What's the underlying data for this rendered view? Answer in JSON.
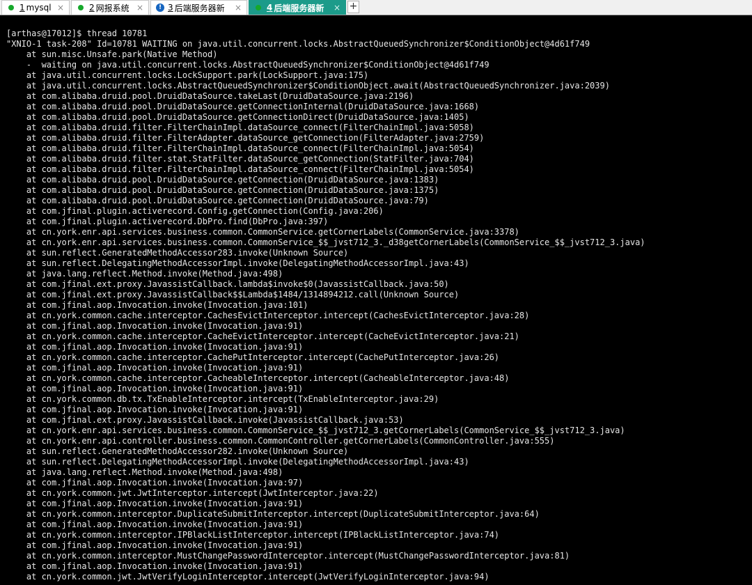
{
  "tabs": [
    {
      "num": "1",
      "label": "mysql",
      "status": "connected",
      "icon": "green-dot-icon",
      "active": false
    },
    {
      "num": "2",
      "label": "网报系统",
      "status": "connected",
      "icon": "green-dot-icon",
      "active": false
    },
    {
      "num": "3",
      "label": "后端服务器新",
      "status": "warning",
      "icon": "info-icon",
      "active": false
    },
    {
      "num": "4",
      "label": "后端服务器新",
      "status": "connected",
      "icon": "green-dot-icon",
      "active": true
    }
  ],
  "add_tab_label": "+",
  "close_label": "×",
  "warn_symbol": "!",
  "colors": {
    "active_tab": "#1c9b8a",
    "connected": "#16a82b",
    "info": "#1565c0",
    "terminal_bg": "#000000",
    "terminal_fg": "#e6e6e6"
  },
  "terminal": {
    "lines": [
      "[arthas@17012]$ thread 10781",
      "\"XNIO-1 task-208\" Id=10781 WAITING on java.util.concurrent.locks.AbstractQueuedSynchronizer$ConditionObject@4d61f749",
      "    at sun.misc.Unsafe.park(Native Method)",
      "    -  waiting on java.util.concurrent.locks.AbstractQueuedSynchronizer$ConditionObject@4d61f749",
      "    at java.util.concurrent.locks.LockSupport.park(LockSupport.java:175)",
      "    at java.util.concurrent.locks.AbstractQueuedSynchronizer$ConditionObject.await(AbstractQueuedSynchronizer.java:2039)",
      "    at com.alibaba.druid.pool.DruidDataSource.takeLast(DruidDataSource.java:2196)",
      "    at com.alibaba.druid.pool.DruidDataSource.getConnectionInternal(DruidDataSource.java:1668)",
      "    at com.alibaba.druid.pool.DruidDataSource.getConnectionDirect(DruidDataSource.java:1405)",
      "    at com.alibaba.druid.filter.FilterChainImpl.dataSource_connect(FilterChainImpl.java:5058)",
      "    at com.alibaba.druid.filter.FilterAdapter.dataSource_getConnection(FilterAdapter.java:2759)",
      "    at com.alibaba.druid.filter.FilterChainImpl.dataSource_connect(FilterChainImpl.java:5054)",
      "    at com.alibaba.druid.filter.stat.StatFilter.dataSource_getConnection(StatFilter.java:704)",
      "    at com.alibaba.druid.filter.FilterChainImpl.dataSource_connect(FilterChainImpl.java:5054)",
      "    at com.alibaba.druid.pool.DruidDataSource.getConnection(DruidDataSource.java:1383)",
      "    at com.alibaba.druid.pool.DruidDataSource.getConnection(DruidDataSource.java:1375)",
      "    at com.alibaba.druid.pool.DruidDataSource.getConnection(DruidDataSource.java:79)",
      "    at com.jfinal.plugin.activerecord.Config.getConnection(Config.java:206)",
      "    at com.jfinal.plugin.activerecord.DbPro.find(DbPro.java:397)",
      "    at cn.york.enr.api.services.business.common.CommonService.getCornerLabels(CommonService.java:3378)",
      "    at cn.york.enr.api.services.business.common.CommonService_$$_jvst712_3._d38getCornerLabels(CommonService_$$_jvst712_3.java)",
      "    at sun.reflect.GeneratedMethodAccessor283.invoke(Unknown Source)",
      "    at sun.reflect.DelegatingMethodAccessorImpl.invoke(DelegatingMethodAccessorImpl.java:43)",
      "    at java.lang.reflect.Method.invoke(Method.java:498)",
      "    at com.jfinal.ext.proxy.JavassistCallback.lambda$invoke$0(JavassistCallback.java:50)",
      "    at com.jfinal.ext.proxy.JavassistCallback$$Lambda$1484/1314894212.call(Unknown Source)",
      "    at com.jfinal.aop.Invocation.invoke(Invocation.java:101)",
      "    at cn.york.common.cache.interceptor.CachesEvictInterceptor.intercept(CachesEvictInterceptor.java:28)",
      "    at com.jfinal.aop.Invocation.invoke(Invocation.java:91)",
      "    at cn.york.common.cache.interceptor.CacheEvictInterceptor.intercept(CacheEvictInterceptor.java:21)",
      "    at com.jfinal.aop.Invocation.invoke(Invocation.java:91)",
      "    at cn.york.common.cache.interceptor.CachePutInterceptor.intercept(CachePutInterceptor.java:26)",
      "    at com.jfinal.aop.Invocation.invoke(Invocation.java:91)",
      "    at cn.york.common.cache.interceptor.CacheableInterceptor.intercept(CacheableInterceptor.java:48)",
      "    at com.jfinal.aop.Invocation.invoke(Invocation.java:91)",
      "    at cn.york.common.db.tx.TxEnableInterceptor.intercept(TxEnableInterceptor.java:29)",
      "    at com.jfinal.aop.Invocation.invoke(Invocation.java:91)",
      "    at com.jfinal.ext.proxy.JavassistCallback.invoke(JavassistCallback.java:53)",
      "    at cn.york.enr.api.services.business.common.CommonService_$$_jvst712_3.getCornerLabels(CommonService_$$_jvst712_3.java)",
      "    at cn.york.enr.api.controller.business.common.CommonController.getCornerLabels(CommonController.java:555)",
      "    at sun.reflect.GeneratedMethodAccessor282.invoke(Unknown Source)",
      "    at sun.reflect.DelegatingMethodAccessorImpl.invoke(DelegatingMethodAccessorImpl.java:43)",
      "    at java.lang.reflect.Method.invoke(Method.java:498)",
      "    at com.jfinal.aop.Invocation.invoke(Invocation.java:97)",
      "    at cn.york.common.jwt.JwtInterceptor.intercept(JwtInterceptor.java:22)",
      "    at com.jfinal.aop.Invocation.invoke(Invocation.java:91)",
      "    at cn.york.common.interceptor.DuplicateSubmitInterceptor.intercept(DuplicateSubmitInterceptor.java:64)",
      "    at com.jfinal.aop.Invocation.invoke(Invocation.java:91)",
      "    at cn.york.common.interceptor.IPBlackListInterceptor.intercept(IPBlackListInterceptor.java:74)",
      "    at com.jfinal.aop.Invocation.invoke(Invocation.java:91)",
      "    at cn.york.common.interceptor.MustChangePasswordInterceptor.intercept(MustChangePasswordInterceptor.java:81)",
      "    at com.jfinal.aop.Invocation.invoke(Invocation.java:91)",
      "    at cn.york.common.jwt.JwtVerifyLoginInterceptor.intercept(JwtVerifyLoginInterceptor.java:94)"
    ]
  }
}
